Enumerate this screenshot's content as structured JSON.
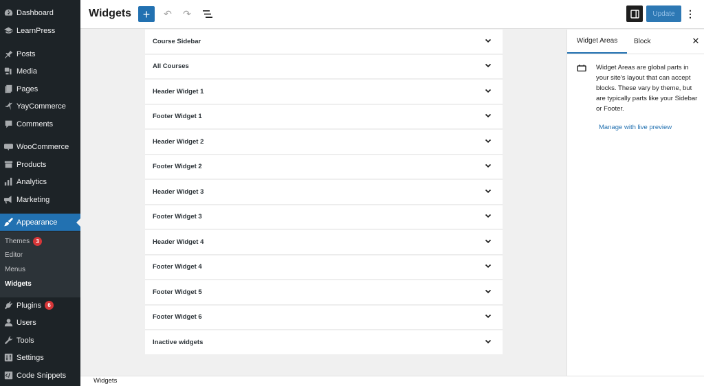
{
  "sidebar": {
    "items": [
      {
        "label": "Dashboard",
        "icon": "dashboard-icon"
      },
      {
        "label": "LearnPress",
        "icon": "learnpress-icon"
      },
      {
        "label": "Posts",
        "icon": "pin-icon"
      },
      {
        "label": "Media",
        "icon": "media-icon"
      },
      {
        "label": "Pages",
        "icon": "pages-icon"
      },
      {
        "label": "YayCommerce",
        "icon": "yaycommerce-icon"
      },
      {
        "label": "Comments",
        "icon": "comment-icon"
      },
      {
        "label": "WooCommerce",
        "icon": "woocommerce-icon"
      },
      {
        "label": "Products",
        "icon": "archive-icon"
      },
      {
        "label": "Analytics",
        "icon": "bar-chart-icon"
      },
      {
        "label": "Marketing",
        "icon": "megaphone-icon"
      },
      {
        "label": "Appearance",
        "icon": "paintbrush-icon",
        "active": true
      },
      {
        "label": "Plugins",
        "icon": "plugin-icon",
        "badge": "6"
      },
      {
        "label": "Users",
        "icon": "user-icon"
      },
      {
        "label": "Tools",
        "icon": "wrench-icon"
      },
      {
        "label": "Settings",
        "icon": "settings-icon"
      },
      {
        "label": "Code Snippets",
        "icon": "code-icon"
      }
    ],
    "submenu": [
      {
        "label": "Themes",
        "badge": "3"
      },
      {
        "label": "Editor"
      },
      {
        "label": "Menus"
      },
      {
        "label": "Widgets",
        "current": true
      }
    ]
  },
  "header": {
    "title": "Widgets",
    "add_icon": "+",
    "undo_icon": "↶",
    "redo_icon": "↷",
    "update_label": "Update",
    "kebab_icon": "⋮"
  },
  "widget_areas": [
    "Course Sidebar",
    "All Courses",
    "Header Widget 1",
    "Footer Widget 1",
    "Header Widget 2",
    "Footer Widget 2",
    "Header Widget 3",
    "Footer Widget 3",
    "Header Widget 4",
    "Footer Widget 4",
    "Footer Widget 5",
    "Footer Widget 6",
    "Inactive widgets"
  ],
  "panel": {
    "tabs": [
      "Widget Areas",
      "Block"
    ],
    "close_icon": "✕",
    "description": "Widget Areas are global parts in your site's layout that can accept blocks. These vary by theme, but are typically parts like your Sidebar or Footer.",
    "link": "Manage with live preview"
  },
  "footer": {
    "breadcrumb": "Widgets"
  },
  "colors": {
    "accent": "#2271b1",
    "sidebar_bg": "#1d2327",
    "badge": "#d63638"
  }
}
